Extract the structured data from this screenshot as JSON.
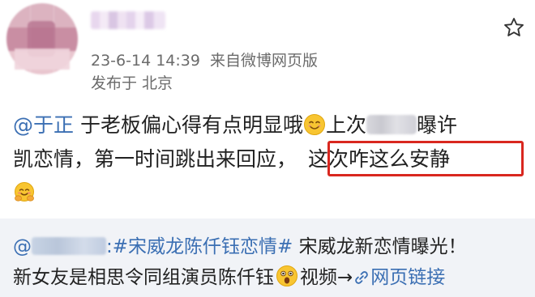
{
  "header": {
    "timestamp": "23-6-14 14:39",
    "source": "来自微博网页版",
    "location": "发布于 北京"
  },
  "post": {
    "mention": "@于正",
    "line1_text": "于老板偏心得有点明显哦",
    "line1_after_emoji": "上次",
    "line1_end": "曝许",
    "line2_start": "凯恋情，第一时间跳出来回应，",
    "highlight_text": "这次咋这么安静",
    "emoji_1": "smile-emoji",
    "emoji_2": "hugging-emoji"
  },
  "repost": {
    "topic": ":#宋威龙陈仟钰恋情#",
    "line1_rest": "宋威龙新恋情曝光！",
    "line2_text": "新女友是相思令同组演员陈仟钰",
    "line2_after_emoji": "视频",
    "arrow": "→",
    "link_label": "网页链接",
    "emoji": "surprised-emoji"
  },
  "icons": {
    "star": "star-icon",
    "link": "link-icon"
  },
  "colors": {
    "link": "#3b6fb3",
    "highlight_border": "#d9271f",
    "meta_text": "#6b6b6b",
    "repost_bg": "#f1f3f7"
  }
}
